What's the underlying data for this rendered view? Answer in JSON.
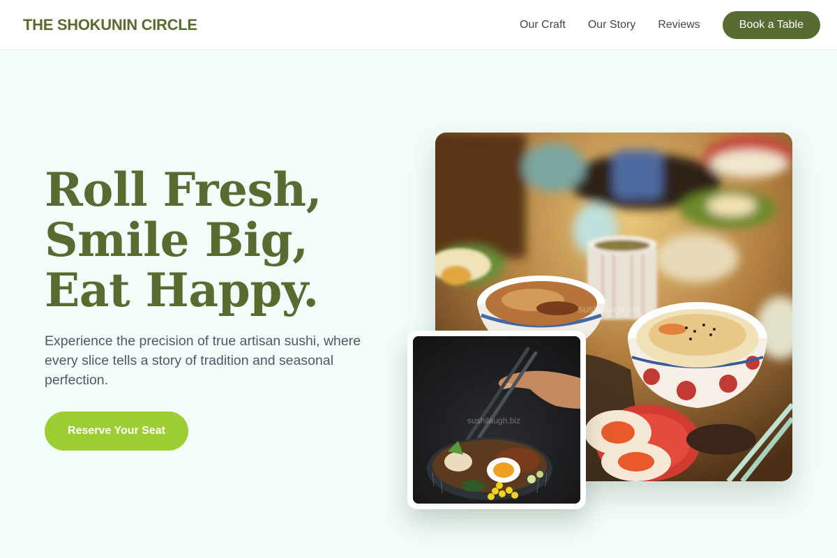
{
  "header": {
    "brand": "THE SHOKUNIN CIRCLE",
    "nav": [
      {
        "label": "Our Craft"
      },
      {
        "label": "Our Story"
      },
      {
        "label": "Reviews"
      }
    ],
    "cta_label": "Book a Table"
  },
  "hero": {
    "title_lines": [
      "Roll Fresh,",
      "Smile Big,",
      "Eat Happy."
    ],
    "subtitle": "Experience the precision of true artisan sushi, where every slice tells a story of tradition and seasonal perfection.",
    "cta_label": "Reserve Your Seat"
  },
  "images": {
    "main": {
      "subject": "table-of-japanese-dishes",
      "watermark": "sushilaugh.biz"
    },
    "small": {
      "subject": "ramen-bowl-with-chopsticks",
      "watermark": "sushilaugh.biz"
    }
  },
  "colors": {
    "brand_green": "#586b30",
    "button_dark_green": "#576b32",
    "button_lime": "#9ccd32",
    "page_background": "#f3fcf8"
  }
}
